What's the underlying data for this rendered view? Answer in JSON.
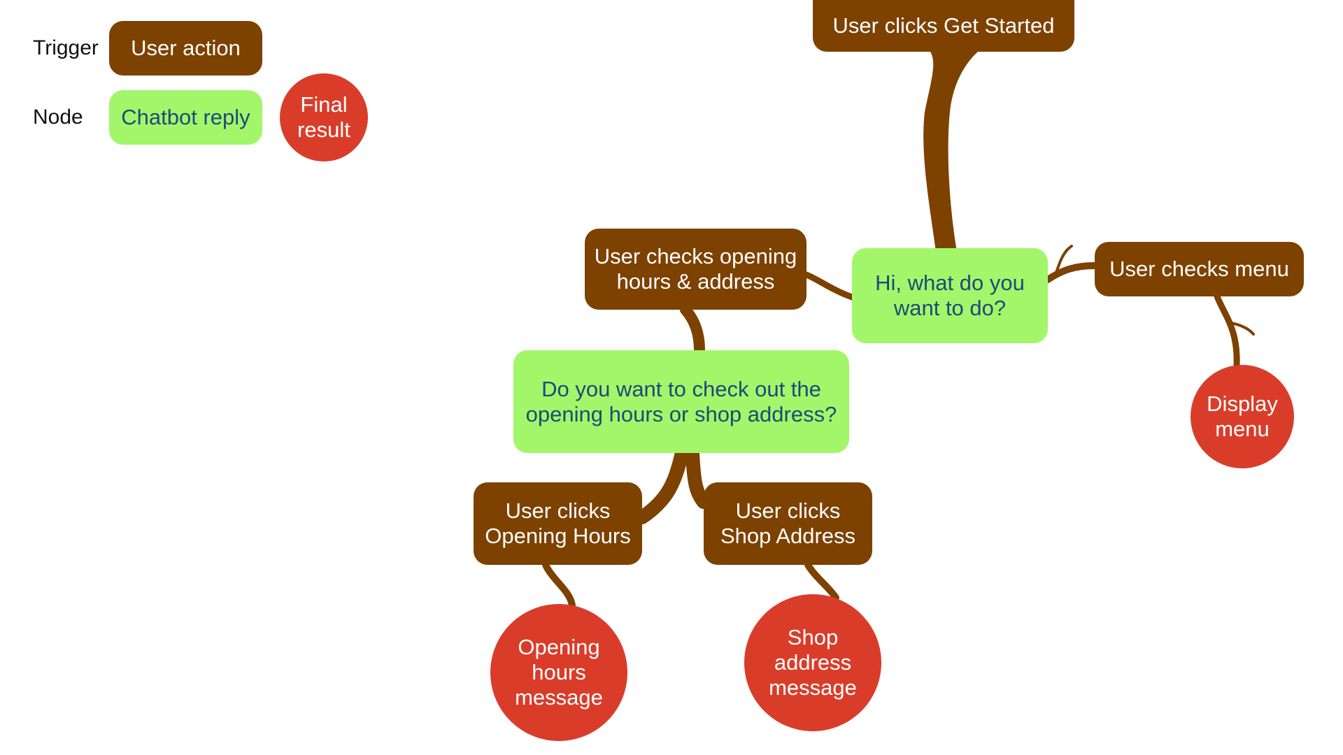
{
  "legend": {
    "trigger_label": "Trigger",
    "trigger_example": "User action",
    "node_label": "Node",
    "node_example": "Chatbot reply",
    "result_example": "Final\nresult"
  },
  "colors": {
    "trigger": "#7d4100",
    "reply": "#a3f66a",
    "reply_text": "#1e4a78",
    "result": "#d93d2a",
    "branch": "#7d4100"
  },
  "flow": {
    "start": "User clicks Get Started",
    "greeting": "Hi, what do you\nwant to do?",
    "check_hours_address": "User checks opening\nhours & address",
    "check_menu": "User checks menu",
    "display_menu": "Display\nmenu",
    "hours_or_address_question": "Do you want to check out the\nopening hours or shop address?",
    "click_opening_hours": "User clicks\nOpening Hours",
    "click_shop_address": "User clicks\nShop Address",
    "opening_hours_message": "Opening\nhours\nmessage",
    "shop_address_message": "Shop\naddress\nmessage"
  }
}
